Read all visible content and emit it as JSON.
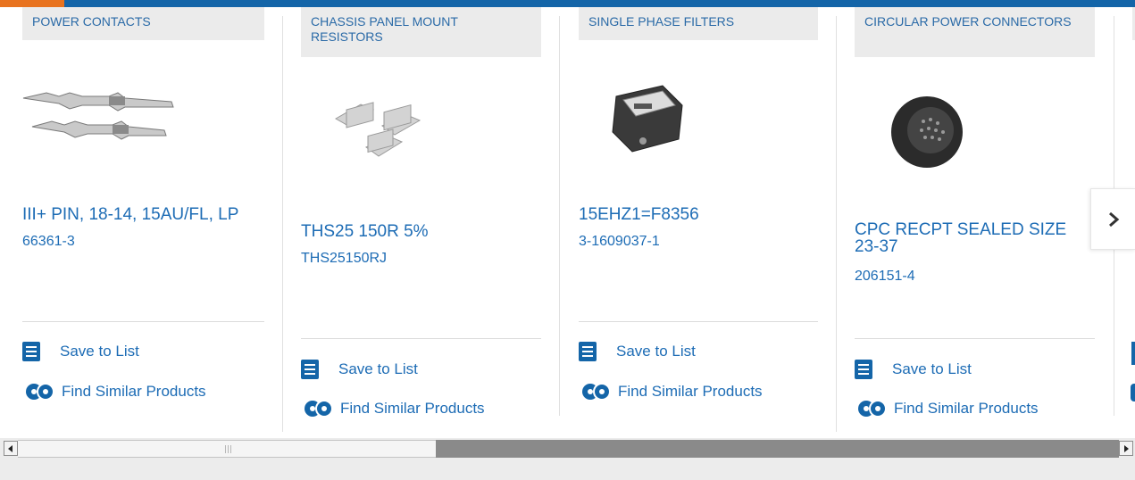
{
  "carousel": {
    "cards": [
      {
        "category": "POWER CONTACTS",
        "name": "III+ PIN, 18-14, 15AU/FL, LP",
        "part_number": "66361-3",
        "save_label": "Save to List",
        "similar_label": "Find Similar Products"
      },
      {
        "category": "CHASSIS PANEL MOUNT RESISTORS",
        "name": "THS25 150R 5%",
        "part_number": "THS25150RJ",
        "save_label": "Save to List",
        "similar_label": "Find Similar Products"
      },
      {
        "category": "SINGLE PHASE FILTERS",
        "name": "15EHZ1=F8356",
        "part_number": "3-1609037-1",
        "save_label": "Save to List",
        "similar_label": "Find Similar Products"
      },
      {
        "category": "CIRCULAR POWER CONNECTORS",
        "name": "CPC RECPT SEALED SIZE 23-37",
        "part_number": "206151-4",
        "save_label": "Save to List",
        "similar_label": "Find Similar Products"
      }
    ],
    "next_icon": "chevron-right-icon"
  },
  "colors": {
    "accent_orange": "#e8731f",
    "brand_blue": "#1465a8",
    "link_blue": "#1d6cb5"
  }
}
